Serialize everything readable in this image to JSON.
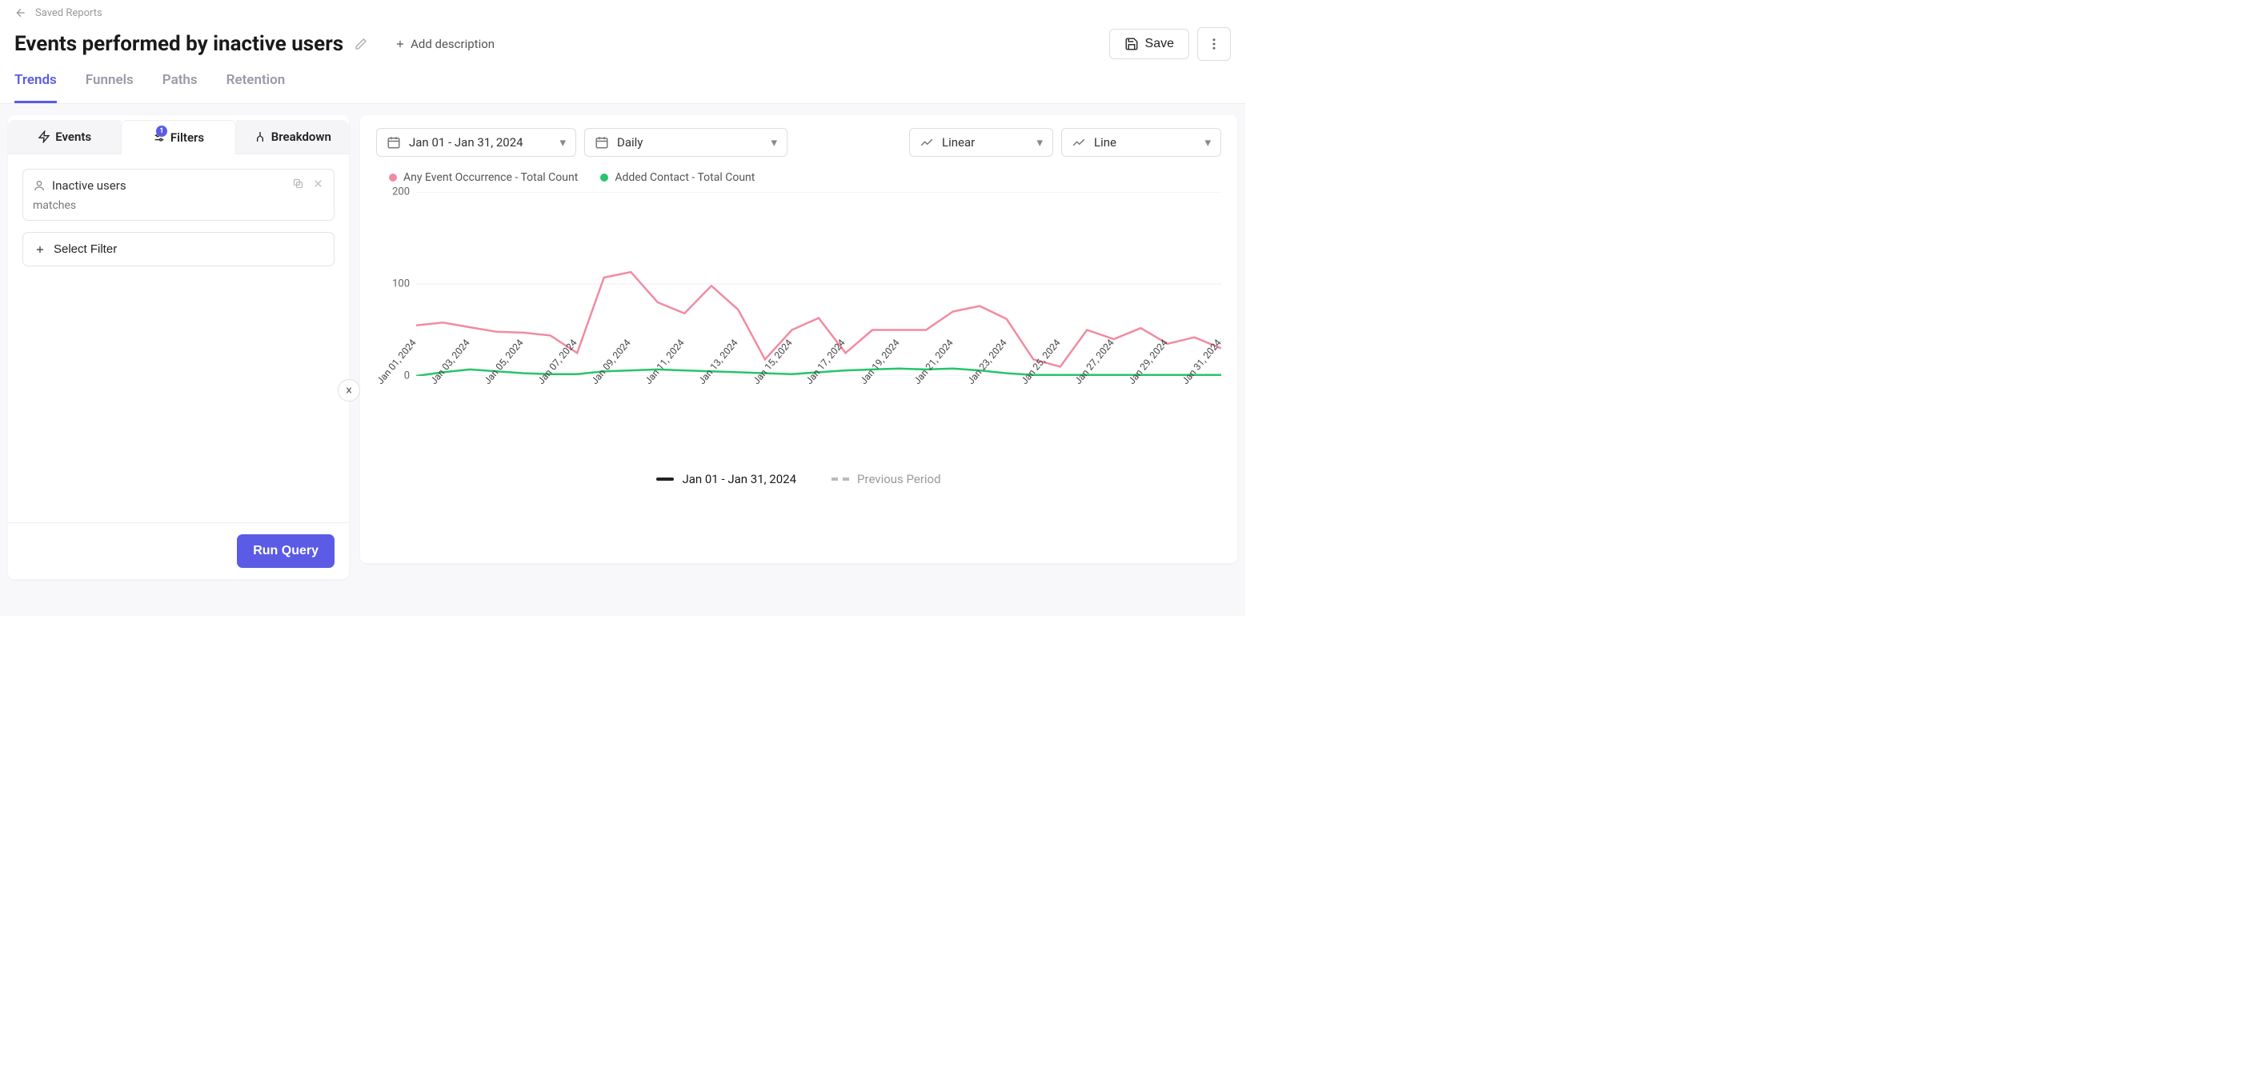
{
  "breadcrumb": {
    "label": "Saved Reports"
  },
  "title": "Events performed by inactive users",
  "add_description_label": "Add description",
  "save_label": "Save",
  "top_tabs": [
    {
      "label": "Trends",
      "active": true
    },
    {
      "label": "Funnels",
      "active": false
    },
    {
      "label": "Paths",
      "active": false
    },
    {
      "label": "Retention",
      "active": false
    }
  ],
  "panel_tabs": {
    "events": "Events",
    "filters": "Filters",
    "filters_badge": "1",
    "breakdown": "Breakdown"
  },
  "filter": {
    "name": "Inactive users",
    "matches_label": "matches"
  },
  "select_filter_label": "Select Filter",
  "run_query_label": "Run Query",
  "controls": {
    "date_range": "Jan 01 - Jan 31, 2024",
    "interval": "Daily",
    "scale": "Linear",
    "chart_type": "Line"
  },
  "legend_bottom": {
    "current": "Jan 01 - Jan 31, 2024",
    "previous": "Previous Period"
  },
  "colors": {
    "series1": "#f28ba0",
    "series2": "#27c46c"
  },
  "chart_data": {
    "type": "line",
    "title": "",
    "xlabel": "",
    "ylabel": "",
    "ylim": [
      0,
      200
    ],
    "yticks": [
      0,
      100,
      200
    ],
    "categories": [
      "Jan 01, 2024",
      "Jan 02, 2024",
      "Jan 03, 2024",
      "Jan 04, 2024",
      "Jan 05, 2024",
      "Jan 06, 2024",
      "Jan 07, 2024",
      "Jan 08, 2024",
      "Jan 09, 2024",
      "Jan 10, 2024",
      "Jan 11, 2024",
      "Jan 12, 2024",
      "Jan 13, 2024",
      "Jan 14, 2024",
      "Jan 15, 2024",
      "Jan 16, 2024",
      "Jan 17, 2024",
      "Jan 18, 2024",
      "Jan 19, 2024",
      "Jan 20, 2024",
      "Jan 21, 2024",
      "Jan 22, 2024",
      "Jan 23, 2024",
      "Jan 24, 2024",
      "Jan 25, 2024",
      "Jan 26, 2024",
      "Jan 27, 2024",
      "Jan 28, 2024",
      "Jan 29, 2024",
      "Jan 30, 2024",
      "Jan 31, 2024"
    ],
    "x_tick_labels": [
      "Jan 01, 2024",
      "Jan 03, 2024",
      "Jan 05, 2024",
      "Jan 07, 2024",
      "Jan 09, 2024",
      "Jan 11, 2024",
      "Jan 13, 2024",
      "Jan 15, 2024",
      "Jan 17, 2024",
      "Jan 19, 2024",
      "Jan 21, 2024",
      "Jan 23, 2024",
      "Jan 25, 2024",
      "Jan 27, 2024",
      "Jan 29, 2024",
      "Jan 31, 2024"
    ],
    "series": [
      {
        "name": "Any Event Occurrence - Total Count",
        "color": "#f28ba0",
        "values": [
          55,
          58,
          53,
          48,
          47,
          44,
          25,
          107,
          113,
          80,
          68,
          98,
          72,
          18,
          50,
          63,
          25,
          50,
          50,
          50,
          70,
          76,
          62,
          18,
          10,
          50,
          40,
          52,
          35,
          42,
          30
        ]
      },
      {
        "name": "Added Contact - Total Count",
        "color": "#27c46c",
        "values": [
          0,
          4,
          7,
          5,
          3,
          2,
          2,
          5,
          6,
          7,
          6,
          5,
          4,
          3,
          2,
          4,
          6,
          7,
          8,
          7,
          8,
          6,
          3,
          1,
          1,
          1,
          1,
          1,
          1,
          1,
          1
        ]
      }
    ]
  }
}
